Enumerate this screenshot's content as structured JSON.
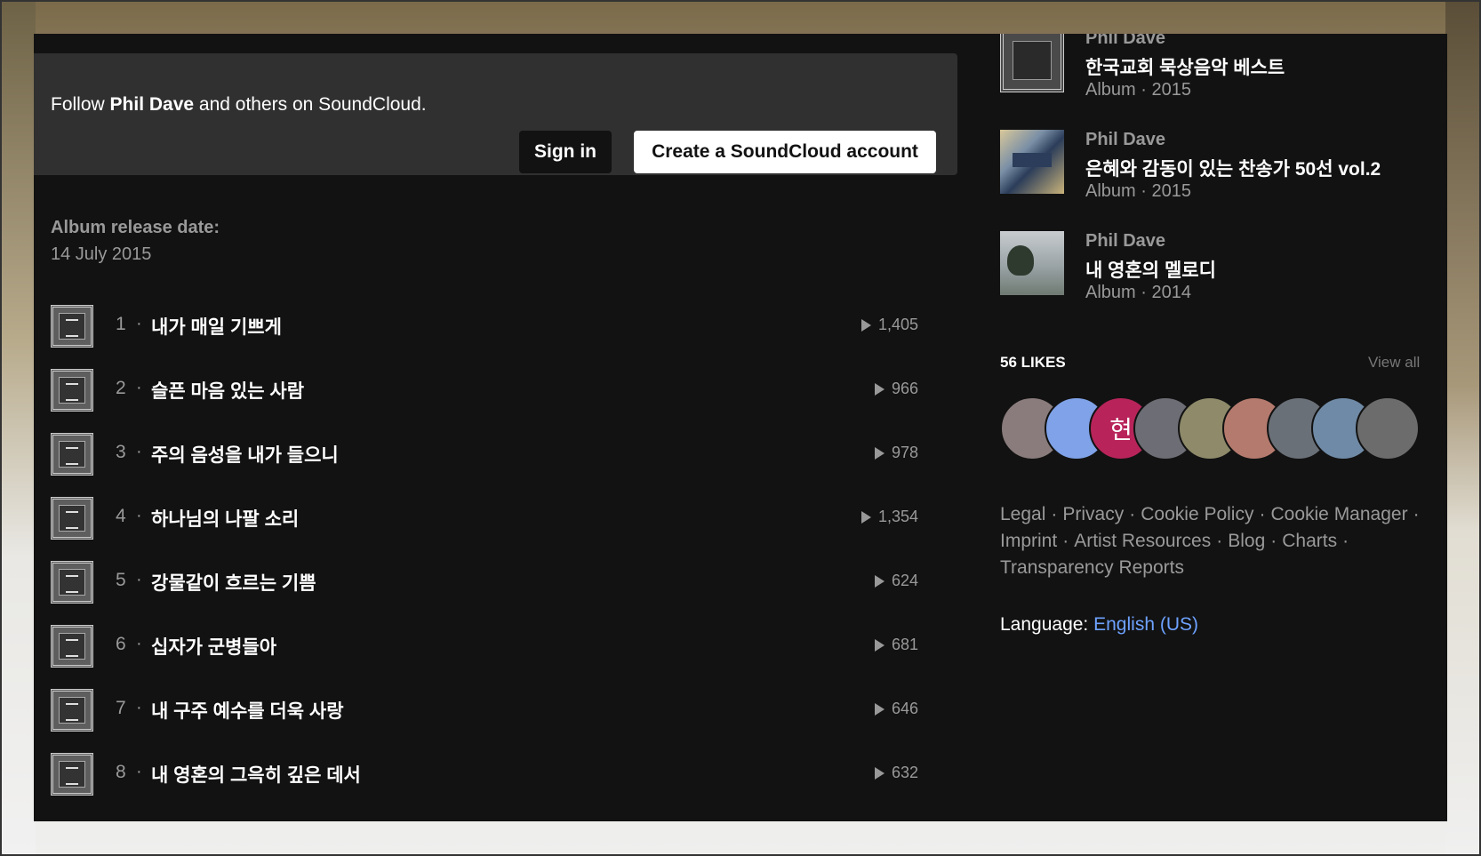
{
  "follow": {
    "prefix": "Follow",
    "artist": "Phil Dave",
    "suffix": "and others on SoundCloud.",
    "signin_label": "Sign in",
    "create_label": "Create a SoundCloud account"
  },
  "release": {
    "label": "Album release date:",
    "date": "14 July 2015"
  },
  "tracks": [
    {
      "num": "1",
      "title": "내가 매일 기쁘게",
      "plays": "1,405"
    },
    {
      "num": "2",
      "title": "슬픈 마음 있는 사람",
      "plays": "966"
    },
    {
      "num": "3",
      "title": "주의 음성을 내가 들으니",
      "plays": "978"
    },
    {
      "num": "4",
      "title": "하나님의 나팔 소리",
      "plays": "1,354"
    },
    {
      "num": "5",
      "title": "강물같이 흐르는 기쁨",
      "plays": "624"
    },
    {
      "num": "6",
      "title": "십자가 군병들아",
      "plays": "681"
    },
    {
      "num": "7",
      "title": "내 구주 예수를 더욱 사랑",
      "plays": "646"
    },
    {
      "num": "8",
      "title": "내 영혼의 그윽히 깊은 데서",
      "plays": "632"
    }
  ],
  "albums": [
    {
      "artist": "Phil Dave",
      "name": "한국교회 묵상음악 베스트",
      "meta": "Album · 2015"
    },
    {
      "artist": "Phil Dave",
      "name": "은혜와 감동이 있는 찬송가 50선 vol.2",
      "meta": "Album · 2015"
    },
    {
      "artist": "Phil Dave",
      "name": "내 영혼의 멜로디",
      "meta": "Album · 2014"
    }
  ],
  "likes": {
    "title": "56 LIKES",
    "view_all": "View all",
    "avatars": [
      {
        "color": "#8a7c7c",
        "text": ""
      },
      {
        "color": "#7fa2e8",
        "text": ""
      },
      {
        "color": "#b8245a",
        "text": "현"
      },
      {
        "color": "#6d6d75",
        "text": ""
      },
      {
        "color": "#8e8a6a",
        "text": ""
      },
      {
        "color": "#b57a6e",
        "text": ""
      },
      {
        "color": "#6a7078",
        "text": ""
      },
      {
        "color": "#6f8aa6",
        "text": ""
      },
      {
        "color": "#6c6c6c",
        "text": ""
      }
    ]
  },
  "footer": {
    "links": [
      "Legal",
      "Privacy",
      "Cookie Policy",
      "Cookie Manager",
      "Imprint",
      "Artist Resources",
      "Blog",
      "Charts",
      "Transparency Reports"
    ],
    "language_label": "Language:",
    "language_value": "English (US)"
  },
  "colors": {
    "background": "#121212",
    "follow_box": "#303030",
    "link_blue": "#6ea2ff",
    "muted_text": "#999999"
  }
}
